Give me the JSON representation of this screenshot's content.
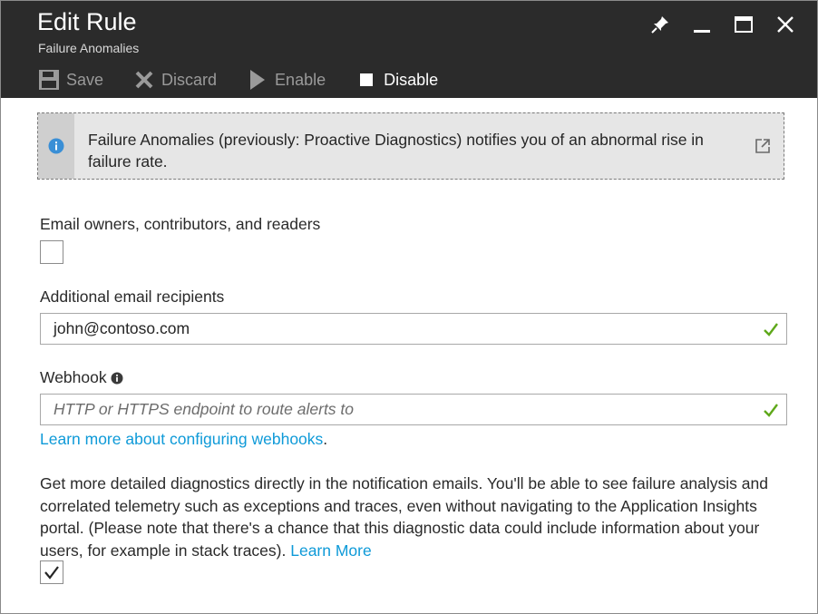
{
  "header": {
    "title": "Edit Rule",
    "subtitle": "Failure Anomalies",
    "window_controls": [
      "pin-icon",
      "minimize-icon",
      "maximize-icon",
      "close-icon"
    ]
  },
  "toolbar": {
    "save_label": "Save",
    "discard_label": "Discard",
    "enable_label": "Enable",
    "disable_label": "Disable"
  },
  "banner": {
    "text": "Failure Anomalies (previously: Proactive Diagnostics) notifies you of an abnormal rise in failure rate.",
    "icon": "info-icon",
    "link_icon": "external-link-icon"
  },
  "form": {
    "email_owners_label": "Email owners, contributors, and readers",
    "email_owners_checked": false,
    "recipients_label": "Additional email recipients",
    "recipients_value": "john@contoso.com",
    "webhook_label": "Webhook",
    "webhook_placeholder": "HTTP or HTTPS endpoint to route alerts to",
    "webhook_link": "Learn more about configuring webhooks",
    "webhook_link_suffix": ".",
    "diagnostics_text": "Get more detailed diagnostics directly in the notification emails. You'll be able to see failure analysis and correlated telemetry such as exceptions and traces, even without navigating to the Application Insights portal. (Please note that there's a chance that this diagnostic data could include information about your users, for example in stack traces).",
    "diagnostics_link": "Learn More",
    "diagnostics_checked": true
  },
  "colors": {
    "header_bg": "#2b2b2b",
    "link": "#0e9ad8",
    "valid_check": "#5ea81a",
    "info_icon": "#3a8fd6"
  }
}
